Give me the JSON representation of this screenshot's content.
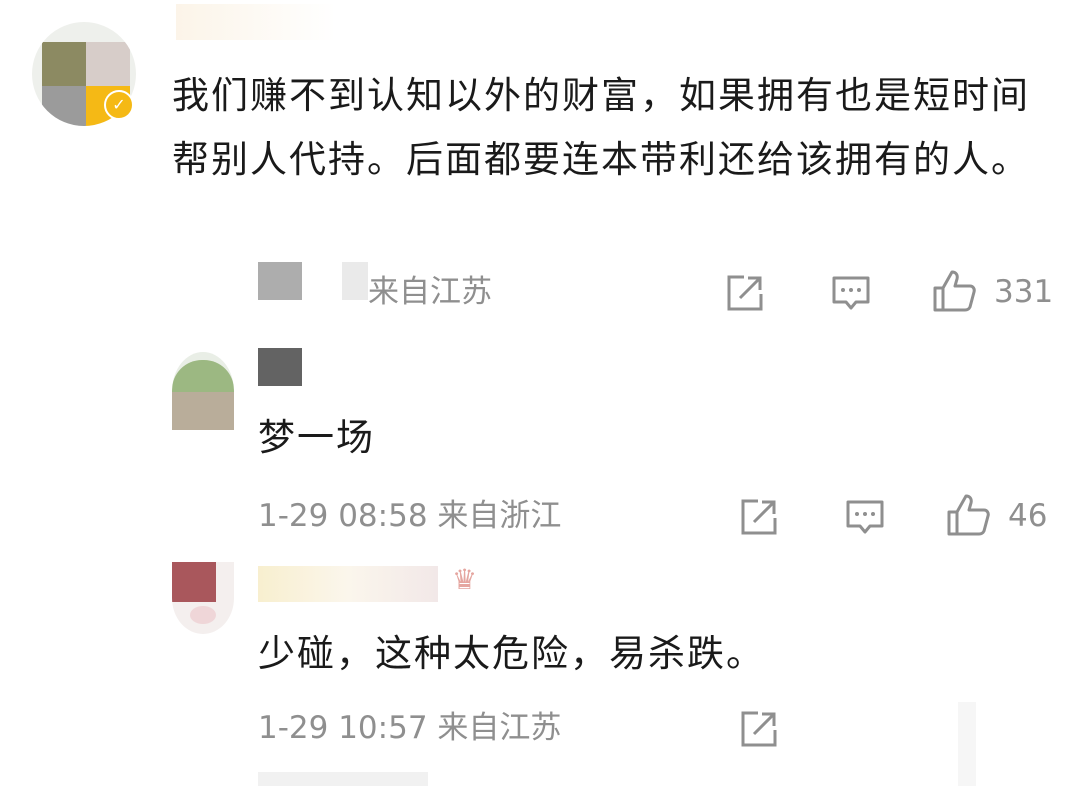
{
  "comments": [
    {
      "text": "我们赚不到认知以外的财富，如果拥有也是短时间帮别人代持。后面都要连本带利还给该拥有的人。",
      "meta": "来自江苏",
      "likes": "331",
      "verified": true
    },
    {
      "text": "梦一场",
      "meta": "1-29 08:58  来自浙江",
      "likes": "46"
    },
    {
      "text": "少碰，这种太危险，易杀跌。",
      "meta": "1-29 10:57  来自江苏"
    }
  ],
  "icons": {
    "share": "share-icon",
    "comment": "comment-icon",
    "like": "like-icon",
    "crown": "crown-icon",
    "verified": "verified-badge-icon"
  },
  "colors": {
    "text": "#1a1a1a",
    "meta": "#8f8f8f",
    "badge": "#f5b915"
  }
}
